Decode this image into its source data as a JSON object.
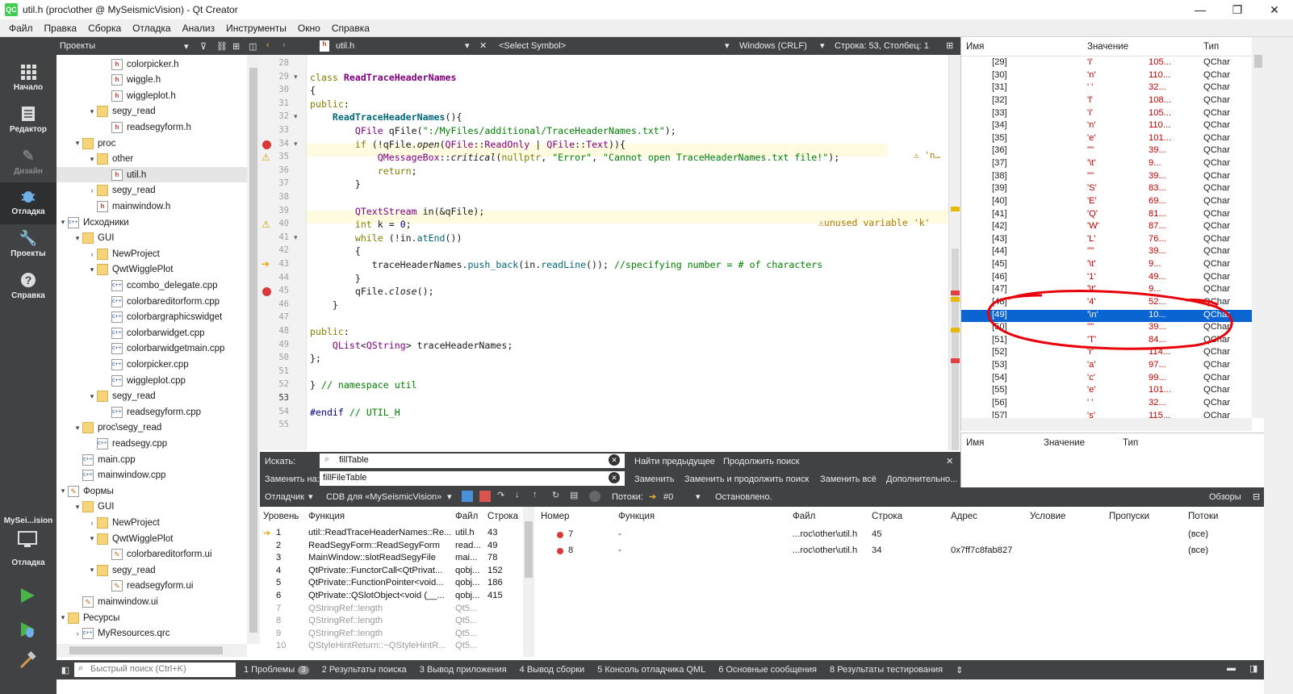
{
  "window": {
    "title": "util.h (proc\\other @ MySeismicVision) - Qt Creator",
    "app_icon": "QC",
    "min": "—",
    "max": "❐",
    "close": "✕"
  },
  "menu": [
    "Файл",
    "Правка",
    "Сборка",
    "Отладка",
    "Анализ",
    "Инструменты",
    "Окно",
    "Справка"
  ],
  "modes": [
    {
      "label": "Начало",
      "icon": "grid-icon"
    },
    {
      "label": "Редактор",
      "icon": "document-icon"
    },
    {
      "label": "Дизайн",
      "icon": "pen-icon"
    },
    {
      "label": "Отладка",
      "icon": "bug-icon"
    },
    {
      "label": "Проекты",
      "icon": "wrench-icon"
    },
    {
      "label": "Справка",
      "icon": "help-icon"
    }
  ],
  "kit": {
    "name": "MySei...ision",
    "label": "Отладка"
  },
  "project_panel": {
    "title": "Проекты"
  },
  "tree": [
    {
      "d": 5,
      "a": "",
      "i": "h",
      "t": "colorpicker.h"
    },
    {
      "d": 5,
      "a": "",
      "i": "h",
      "t": "wiggle.h"
    },
    {
      "d": 5,
      "a": "",
      "i": "h",
      "t": "wiggleplot.h"
    },
    {
      "d": 4,
      "a": "▾",
      "i": "folder",
      "t": "segy_read"
    },
    {
      "d": 5,
      "a": "",
      "i": "h",
      "t": "readsegyform.h"
    },
    {
      "d": 3,
      "a": "▾",
      "i": "folder",
      "t": "proc"
    },
    {
      "d": 4,
      "a": "▾",
      "i": "folder",
      "t": "other"
    },
    {
      "d": 5,
      "a": "",
      "i": "h",
      "t": "util.h",
      "sel": true
    },
    {
      "d": 4,
      "a": "›",
      "i": "folder",
      "t": "segy_read"
    },
    {
      "d": 4,
      "a": "",
      "i": "h",
      "t": "mainwindow.h"
    },
    {
      "d": 2,
      "a": "▾",
      "i": "cpp",
      "t": "Исходники"
    },
    {
      "d": 3,
      "a": "▾",
      "i": "folder",
      "t": "GUI"
    },
    {
      "d": 4,
      "a": "›",
      "i": "folder",
      "t": "NewProject"
    },
    {
      "d": 4,
      "a": "▾",
      "i": "folder",
      "t": "QwtWigglePlot"
    },
    {
      "d": 5,
      "a": "",
      "i": "cpp",
      "t": "ccombo_delegate.cpp"
    },
    {
      "d": 5,
      "a": "",
      "i": "cpp",
      "t": "colorbareditorform.cpp"
    },
    {
      "d": 5,
      "a": "",
      "i": "cpp",
      "t": "colorbargraphicswidget"
    },
    {
      "d": 5,
      "a": "",
      "i": "cpp",
      "t": "colorbarwidget.cpp"
    },
    {
      "d": 5,
      "a": "",
      "i": "cpp",
      "t": "colorbarwidgetmain.cpp"
    },
    {
      "d": 5,
      "a": "",
      "i": "cpp",
      "t": "colorpicker.cpp"
    },
    {
      "d": 5,
      "a": "",
      "i": "cpp",
      "t": "wiggleplot.cpp"
    },
    {
      "d": 4,
      "a": "▾",
      "i": "folder",
      "t": "segy_read"
    },
    {
      "d": 5,
      "a": "",
      "i": "cpp",
      "t": "readsegyform.cpp"
    },
    {
      "d": 3,
      "a": "▾",
      "i": "folder",
      "t": "proc\\segy_read"
    },
    {
      "d": 4,
      "a": "",
      "i": "cpp",
      "t": "readsegy.cpp"
    },
    {
      "d": 3,
      "a": "",
      "i": "cpp",
      "t": "main.cpp"
    },
    {
      "d": 3,
      "a": "",
      "i": "cpp",
      "t": "mainwindow.cpp"
    },
    {
      "d": 2,
      "a": "▾",
      "i": "ui",
      "t": "Формы"
    },
    {
      "d": 3,
      "a": "▾",
      "i": "folder",
      "t": "GUI"
    },
    {
      "d": 4,
      "a": "›",
      "i": "folder",
      "t": "NewProject"
    },
    {
      "d": 4,
      "a": "▾",
      "i": "folder",
      "t": "QwtWigglePlot"
    },
    {
      "d": 5,
      "a": "",
      "i": "ui",
      "t": "colorbareditorform.ui"
    },
    {
      "d": 4,
      "a": "▾",
      "i": "folder",
      "t": "segy_read"
    },
    {
      "d": 5,
      "a": "",
      "i": "ui",
      "t": "readsegyform.ui"
    },
    {
      "d": 3,
      "a": "",
      "i": "ui",
      "t": "mainwindow.ui"
    },
    {
      "d": 2,
      "a": "▾",
      "i": "folder",
      "t": "Ресурсы"
    },
    {
      "d": 3,
      "a": "›",
      "i": "pro",
      "t": "MyResources.qrc"
    }
  ],
  "editor": {
    "file": "util.h",
    "symbol": "<Select Symbol>",
    "eol": "Windows (CRLF)",
    "position": "Строка: 53, Столбец: 1"
  },
  "code": [
    {
      "n": "28",
      "h": ""
    },
    {
      "n": "29",
      "h": "<span class='kw'>class</span> <span class='ty'><b>ReadTraceHeaderNames</b></span>"
    },
    {
      "n": "30",
      "h": "{"
    },
    {
      "n": "31",
      "h": "<span class='kw'>public</span>:"
    },
    {
      "n": "32",
      "h": "    <span class='fn'><b>ReadTraceHeaderNames</b></span>(){"
    },
    {
      "n": "33",
      "h": "        <span class='ty'>QFile</span> qFile(<span class='st'>\":/MyFiles/additional/TraceHeaderNames.txt\"</span>);"
    },
    {
      "n": "34",
      "h": "        <span class='kw'>if</span> (!qFile.<i>open</i>(<span class='ty'>QFile</span>::<span class='ty'>ReadOnly</span> | <span class='ty'>QFile</span>::<span class='ty'>Text</span>)){"
    },
    {
      "n": "35",
      "h": "            <span class='ty'>QMessageBox</span>::<i>critical</i>(<span class='kw'>nullptr</span>, <span class='st'>\"Error\"</span>, <span class='st'>\"Cannot open TraceHeaderNames.txt file!\"</span>);"
    },
    {
      "n": "36",
      "h": "            <span class='kw'>return</span>;"
    },
    {
      "n": "37",
      "h": "        }"
    },
    {
      "n": "38",
      "h": ""
    },
    {
      "n": "39",
      "h": "        <span class='ty'>QTextStream</span> in(&amp;qFile);"
    },
    {
      "n": "40",
      "h": "        <span class='kw'>int</span> k = <span class='nm'>0</span>;"
    },
    {
      "n": "41",
      "h": "        <span class='kw'>while</span> (!in.<span class='fn'>atEnd</span>())"
    },
    {
      "n": "42",
      "h": "        {"
    },
    {
      "n": "43",
      "h": "           traceHeaderNames.<span class='fn'>push_back</span>(in.<span class='fn'>readLine</span>()); <span class='cm'>//specifying number = # of characters</span>"
    },
    {
      "n": "44",
      "h": "        }"
    },
    {
      "n": "45",
      "h": "        qFile.<i>close</i>();"
    },
    {
      "n": "46",
      "h": "    }"
    },
    {
      "n": "47",
      "h": ""
    },
    {
      "n": "48",
      "h": "<span class='kw'>public</span>:"
    },
    {
      "n": "49",
      "h": "    <span class='ty'>QList</span>&lt;<span class='ty'>QString</span>&gt; traceHeaderNames;"
    },
    {
      "n": "50",
      "h": "};"
    },
    {
      "n": "51",
      "h": ""
    },
    {
      "n": "52",
      "h": "} <span class='cm'>// namespace util</span>"
    },
    {
      "n": "53",
      "h": ""
    },
    {
      "n": "54",
      "h": "<span class='pp'>#endif</span> <span class='cm'>// UTIL_H</span>"
    },
    {
      "n": "55",
      "h": ""
    }
  ],
  "annotations": {
    "l35": "⚠ 'n…",
    "l40": "⚠unused variable 'k'"
  },
  "watch": {
    "headers": [
      "Имя",
      "Значение",
      "Тип"
    ],
    "rows": [
      [
        "[29]",
        "'i'",
        "105...",
        "QChar"
      ],
      [
        "[30]",
        "'n'",
        "110...",
        "QChar"
      ],
      [
        "[31]",
        "' '",
        "32...",
        "QChar"
      ],
      [
        "[32]",
        "'l'",
        "108...",
        "QChar"
      ],
      [
        "[33]",
        "'i'",
        "105...",
        "QChar"
      ],
      [
        "[34]",
        "'n'",
        "110...",
        "QChar"
      ],
      [
        "[35]",
        "'e'",
        "101...",
        "QChar"
      ],
      [
        "[36]",
        "'\"'",
        "39...",
        "QChar"
      ],
      [
        "[37]",
        "'\\t'",
        "9...",
        "QChar"
      ],
      [
        "[38]",
        "'\"'",
        "39...",
        "QChar"
      ],
      [
        "[39]",
        "'S'",
        "83...",
        "QChar"
      ],
      [
        "[40]",
        "'E'",
        "69...",
        "QChar"
      ],
      [
        "[41]",
        "'Q'",
        "81...",
        "QChar"
      ],
      [
        "[42]",
        "'W'",
        "87...",
        "QChar"
      ],
      [
        "[43]",
        "'L'",
        "76...",
        "QChar"
      ],
      [
        "[44]",
        "'\"'",
        "39...",
        "QChar"
      ],
      [
        "[45]",
        "'\\t'",
        "9...",
        "QChar"
      ],
      [
        "[46]",
        "'1'",
        "49...",
        "QChar"
      ],
      [
        "[47]",
        "'\\t'",
        "9...",
        "QChar"
      ],
      [
        "[48]",
        "'4'",
        "52...",
        "QChar"
      ],
      [
        "[49]",
        "'\\n'",
        "10...",
        "QChar"
      ],
      [
        "[50]",
        "'\"'",
        "39...",
        "QChar"
      ],
      [
        "[51]",
        "'T'",
        "84...",
        "QChar"
      ],
      [
        "[52]",
        "'r'",
        "114...",
        "QChar"
      ],
      [
        "[53]",
        "'a'",
        "97...",
        "QChar"
      ],
      [
        "[54]",
        "'c'",
        "99...",
        "QChar"
      ],
      [
        "[55]",
        "'e'",
        "101...",
        "QChar"
      ],
      [
        "[56]",
        "' '",
        "32...",
        "QChar"
      ],
      [
        "[57]",
        "'s'",
        "115...",
        "QChar"
      ]
    ],
    "lower_headers": [
      "Имя",
      "Значение",
      "Тип"
    ]
  },
  "find": {
    "search_label": "Искать:",
    "search_value": "fillTable",
    "replace_label": "Заменить на:",
    "replace_value": "fillFileTable",
    "find_prev": "Найти предыдущее",
    "find_next": "Продолжить поиск",
    "replace": "Заменить",
    "replace_find": "Заменить и продолжить поиск",
    "replace_all": "Заменить всё",
    "advanced": "Дополнительно..."
  },
  "debug": {
    "debugger": "Отладчик",
    "engine": "CDB для «MySeismicVision»",
    "threads_label": "Потоки:",
    "thread": "#0",
    "state": "Остановлено.",
    "views": "Обзоры"
  },
  "stack": {
    "headers": [
      "Уровень",
      "Функция",
      "Файл",
      "Строка"
    ],
    "rows": [
      [
        "1",
        "util::ReadTraceHeaderNames::Re...",
        "util.h",
        "43"
      ],
      [
        "2",
        "ReadSegyForm::ReadSegyForm",
        "read...",
        "49"
      ],
      [
        "3",
        "MainWindow::slotReadSegyFile",
        "mai...",
        "78"
      ],
      [
        "4",
        "QtPrivate::FunctorCall<QtPrivat...",
        "qobj...",
        "152"
      ],
      [
        "5",
        "QtPrivate::FunctionPointer<void...",
        "qobj...",
        "186"
      ],
      [
        "6",
        "QtPrivate::QSlotObject<void (__...",
        "qobj...",
        "415"
      ],
      [
        "7",
        "QStringRef::length",
        "Qt5...",
        ""
      ],
      [
        "8",
        "QStringRef::length",
        "Qt5...",
        ""
      ],
      [
        "9",
        "QStringRef::length",
        "Qt5...",
        ""
      ],
      [
        "10",
        "QStyleHintReturn::~QStyleHintR...",
        "Qt5...",
        ""
      ]
    ]
  },
  "breakpoints": {
    "headers": [
      "Номер",
      "Функция",
      "Файл",
      "Строка",
      "Адрес",
      "Условие",
      "Пропуски",
      "Потоки"
    ],
    "rows": [
      [
        "7",
        "-",
        "...roc\\other\\util.h",
        "45",
        "",
        "",
        "",
        "(все)"
      ],
      [
        "8",
        "-",
        "...roc\\other\\util.h",
        "34",
        "0x7ff7c8fab827",
        "",
        "",
        "(все)"
      ]
    ]
  },
  "status": {
    "search_placeholder": "Быстрый поиск (Ctrl+K)",
    "tabs": [
      "1  Проблемы",
      "2  Результаты поиска",
      "3  Вывод приложения",
      "4  Вывод сборки",
      "5  Консоль отладчика QML",
      "6  Основные сообщения",
      "8  Результаты тестирования"
    ],
    "problems_count": "3"
  },
  "colors": {
    "dark": "#404244",
    "selection": "#0a64d2",
    "annotation_red": "#e8000b"
  }
}
